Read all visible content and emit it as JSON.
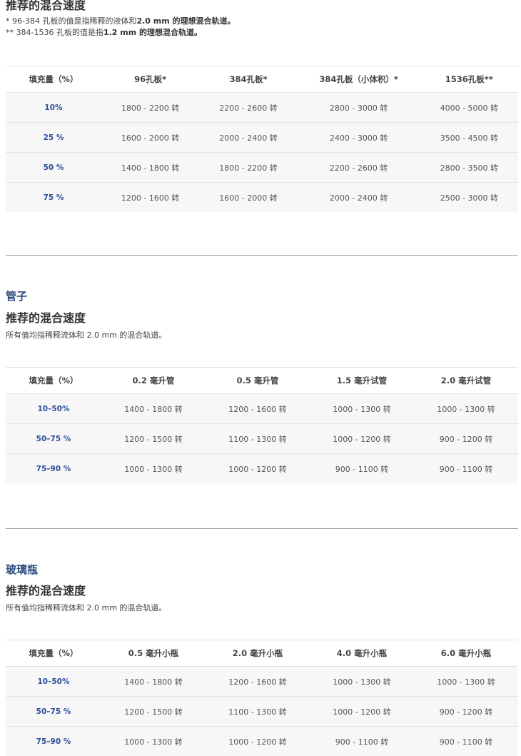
{
  "plates": {
    "heading": "推荐的混合速度",
    "note1_pre": "* 96-384 孔板的值是指稀释的液体和",
    "note1_bold": "2.0 mm 的理想混合轨道。",
    "note2_pre": "** 384-1536 孔板的值是指",
    "note2_bold": "1.2 mm 的理想混合轨道。",
    "headers": [
      "填充量（%）",
      "96孔板*",
      "384孔板*",
      "384孔板（小体积）*",
      "1536孔板**"
    ],
    "rows": [
      {
        "fill": "10%",
        "cells": [
          "1800 - 2200 转",
          "2200 - 2600 转",
          "2800 - 3000 转",
          "4000 - 5000 转"
        ]
      },
      {
        "fill": "25 %",
        "cells": [
          "1600 - 2000 转",
          "2000 - 2400 转",
          "2400 - 3000 转",
          "3500 - 4500 转"
        ]
      },
      {
        "fill": "50 %",
        "cells": [
          "1400 - 1800 转",
          "1800 - 2200 转",
          "2200 - 2600 转",
          "2800 - 3500 转"
        ]
      },
      {
        "fill": "75 %",
        "cells": [
          "1200 - 1600 转",
          "1600 - 2000 转",
          "2000 - 2400 转",
          "2500 - 3000 转"
        ]
      }
    ]
  },
  "tubes": {
    "title": "管子",
    "heading": "推荐的混合速度",
    "note": "所有值均指稀释流体和 2.0 mm 的混合轨道。",
    "headers": [
      "填充量（%）",
      "0.2 毫升管",
      "0.5 毫升管",
      "1.5 毫升试管",
      "2.0 毫升试管"
    ],
    "rows": [
      {
        "fill": "10–50%",
        "cells": [
          "1400 - 1800 转",
          "1200 - 1600 转",
          "1000 - 1300 转",
          "1000 - 1300 转"
        ]
      },
      {
        "fill": "50–75 %",
        "cells": [
          "1200 - 1500 转",
          "1100 - 1300 转",
          "1000 - 1200 转",
          "900 - 1200 转"
        ]
      },
      {
        "fill": "75–90 %",
        "cells": [
          "1000 - 1300 转",
          "1000 - 1200 转",
          "900 - 1100 转",
          "900 - 1100 转"
        ]
      }
    ]
  },
  "vials": {
    "title": "玻璃瓶",
    "heading": "推荐的混合速度",
    "note": "所有值均指稀释流体和 2.0 mm 的混合轨道。",
    "headers": [
      "填充量（%）",
      "0.5 毫升小瓶",
      "2.0 毫升小瓶",
      "4.0 毫升小瓶",
      "6.0 毫升小瓶"
    ],
    "rows": [
      {
        "fill": "10–50%",
        "cells": [
          "1400 - 1800 转",
          "1200 - 1600 转",
          "1000 - 1300 转",
          "1000 - 1300 转"
        ]
      },
      {
        "fill": "50–75 %",
        "cells": [
          "1200 - 1500 转",
          "1100 - 1300 转",
          "1000 - 1200 转",
          "900 - 1200 转"
        ]
      },
      {
        "fill": "75–90 %",
        "cells": [
          "1000 - 1300 转",
          "1000 - 1200 转",
          "900 - 1100 转",
          "900 - 1100 转"
        ]
      }
    ]
  }
}
